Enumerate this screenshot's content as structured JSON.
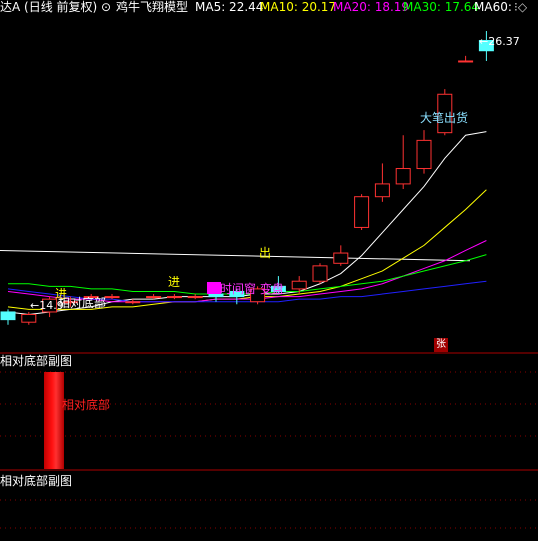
{
  "header": {
    "stock_name": "达A (日线 前复权)",
    "indicator_name": "鸡牛飞翔模型",
    "ma5": {
      "label": "MA5: 22.44",
      "color": "#ffffff"
    },
    "ma10": {
      "label": "MA10: 20.17",
      "color": "#ffff00"
    },
    "ma20": {
      "label": "MA20: 18.19",
      "color": "#ff00ff"
    },
    "ma30": {
      "label": "MA30: 17.64",
      "color": "#00ff00"
    },
    "ma60": {
      "label": "MA60: ",
      "color": "#ffffff"
    }
  },
  "annotations": {
    "high_price": "26.37",
    "low_price": "14.9",
    "big_pen_ship": "大笔出货",
    "relative_bottom": "相对底部",
    "change_plate": "时间窗 变盘",
    "enter_1": "进",
    "enter_2": "进",
    "exit_1": "出",
    "zhang": "张"
  },
  "sub_panel_1": {
    "title": "相对底部副图",
    "bar_label": "相对底部",
    "signal_value": 1
  },
  "sub_panel_2": {
    "title": "相对底部副图"
  },
  "colors": {
    "up_candle": "#ff3232",
    "down_candle": "#54ffff",
    "panel_border": "#aa0000",
    "grid": "#880000",
    "signal_bar": "#ff0000",
    "ma60_line": "#2020ff"
  },
  "chart_data": {
    "type": "candlestick",
    "candles": [
      {
        "o": 15.4,
        "c": 15.1,
        "h": 15.5,
        "l": 14.9
      },
      {
        "o": 15.0,
        "c": 15.3,
        "h": 15.4,
        "l": 14.9
      },
      {
        "o": 15.4,
        "c": 15.9,
        "h": 16.0,
        "l": 15.2
      },
      {
        "o": 15.8,
        "c": 15.8,
        "h": 16.0,
        "l": 15.6
      },
      {
        "o": 16.0,
        "c": 16.0,
        "h": 16.1,
        "l": 15.9
      },
      {
        "o": 16.0,
        "c": 16.0,
        "h": 16.1,
        "l": 15.9
      },
      {
        "o": 15.8,
        "c": 15.8,
        "h": 15.9,
        "l": 15.7
      },
      {
        "o": 16.0,
        "c": 16.0,
        "h": 16.1,
        "l": 15.9
      },
      {
        "o": 16.0,
        "c": 16.0,
        "h": 16.1,
        "l": 15.9
      },
      {
        "o": 16.0,
        "c": 16.0,
        "h": 16.1,
        "l": 15.9
      },
      {
        "o": 16.1,
        "c": 16.0,
        "h": 16.5,
        "l": 15.8
      },
      {
        "o": 16.2,
        "c": 16.0,
        "h": 16.3,
        "l": 15.7
      },
      {
        "o": 15.8,
        "c": 16.3,
        "h": 16.4,
        "l": 15.7
      },
      {
        "o": 16.4,
        "c": 16.2,
        "h": 16.8,
        "l": 16.1
      },
      {
        "o": 16.3,
        "c": 16.6,
        "h": 16.8,
        "l": 16.1
      },
      {
        "o": 16.6,
        "c": 17.2,
        "h": 17.3,
        "l": 16.5
      },
      {
        "o": 17.3,
        "c": 17.7,
        "h": 18.0,
        "l": 17.2
      },
      {
        "o": 18.7,
        "c": 19.9,
        "h": 20.0,
        "l": 18.6
      },
      {
        "o": 19.9,
        "c": 20.4,
        "h": 21.2,
        "l": 19.7
      },
      {
        "o": 20.4,
        "c": 21.0,
        "h": 22.3,
        "l": 20.2
      },
      {
        "o": 21.0,
        "c": 22.1,
        "h": 22.5,
        "l": 20.8
      },
      {
        "o": 22.4,
        "c": 23.9,
        "h": 24.1,
        "l": 22.3
      },
      {
        "o": 25.2,
        "c": 25.2,
        "h": 25.4,
        "l": 25.2
      },
      {
        "o": 26.0,
        "c": 25.6,
        "h": 26.37,
        "l": 25.2
      }
    ],
    "ylim": [
      14.5,
      26.8
    ],
    "moving_averages": [
      {
        "name": "MA5",
        "values": [
          15.4,
          15.3,
          15.4,
          15.5,
          15.6,
          15.8,
          15.9,
          15.9,
          16.0,
          16.0,
          16.0,
          16.0,
          16.1,
          16.1,
          16.2,
          16.5,
          16.9,
          17.6,
          18.5,
          19.4,
          20.3,
          21.4,
          22.3,
          22.44
        ]
      },
      {
        "name": "MA10",
        "values": [
          15.6,
          15.5,
          15.5,
          15.5,
          15.5,
          15.6,
          15.6,
          15.7,
          15.8,
          15.8,
          15.9,
          15.9,
          16.0,
          16.0,
          16.1,
          16.2,
          16.4,
          16.7,
          17.0,
          17.5,
          18.0,
          18.7,
          19.4,
          20.17
        ]
      },
      {
        "name": "MA20",
        "values": [
          16.2,
          16.1,
          16.0,
          15.9,
          15.9,
          15.8,
          15.8,
          15.8,
          15.8,
          15.8,
          15.9,
          15.9,
          15.9,
          16.0,
          16.0,
          16.1,
          16.2,
          16.3,
          16.5,
          16.8,
          17.1,
          17.4,
          17.8,
          18.19
        ]
      },
      {
        "name": "MA30",
        "values": [
          16.5,
          16.5,
          16.4,
          16.4,
          16.3,
          16.3,
          16.2,
          16.2,
          16.2,
          16.1,
          16.1,
          16.1,
          16.1,
          16.2,
          16.2,
          16.3,
          16.4,
          16.5,
          16.6,
          16.8,
          17.0,
          17.2,
          17.4,
          17.64
        ]
      },
      {
        "name": "MA60",
        "values": [
          16.3,
          16.2,
          16.1,
          16.0,
          15.9,
          15.9,
          15.8,
          15.8,
          15.8,
          15.8,
          15.8,
          15.8,
          15.8,
          15.8,
          15.9,
          15.9,
          16.0,
          16.0,
          16.1,
          16.2,
          16.3,
          16.4,
          16.5,
          16.6
        ]
      }
    ]
  }
}
